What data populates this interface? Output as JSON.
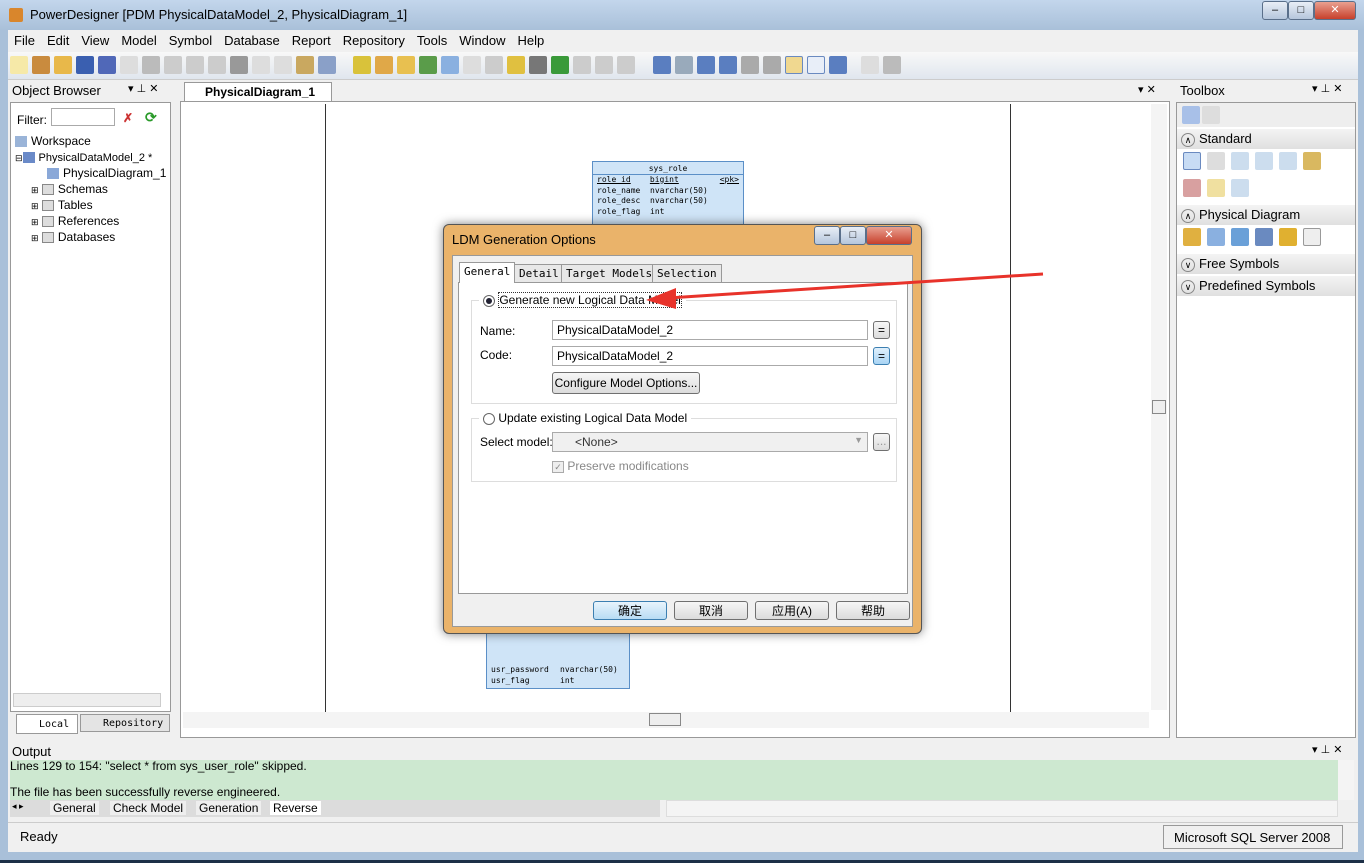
{
  "window": {
    "title": "PowerDesigner [PDM PhysicalDataModel_2, PhysicalDiagram_1]",
    "minimize": "–",
    "maximize": "□",
    "close": "✕"
  },
  "menu": [
    "File",
    "Edit",
    "View",
    "Model",
    "Symbol",
    "Database",
    "Report",
    "Repository",
    "Tools",
    "Window",
    "Help"
  ],
  "object_browser": {
    "title": "Object Browser",
    "filter_label": "Filter:",
    "filter_value": "",
    "tree": [
      {
        "label": "Workspace"
      },
      {
        "label": "PhysicalDataModel_2 *"
      },
      {
        "label": "PhysicalDiagram_1"
      },
      {
        "label": "Schemas"
      },
      {
        "label": "Tables"
      },
      {
        "label": "References"
      },
      {
        "label": "Databases"
      }
    ],
    "tabs": [
      "Local",
      "Repository"
    ]
  },
  "diagram": {
    "tab": "PhysicalDiagram_1",
    "sys_role": {
      "name": "sys_role",
      "columns": [
        {
          "name": "role_id",
          "type": "bigint",
          "key": "<pk>"
        },
        {
          "name": "role_name",
          "type": "nvarchar(50)",
          "key": ""
        },
        {
          "name": "role_desc",
          "type": "nvarchar(50)",
          "key": ""
        },
        {
          "name": "role_flag",
          "type": "int",
          "key": ""
        }
      ]
    },
    "sys_user": {
      "columns": [
        {
          "name": "usr_password",
          "type": "nvarchar(50)"
        },
        {
          "name": "usr_flag",
          "type": "int"
        }
      ]
    }
  },
  "toolbox": {
    "title": "Toolbox",
    "sections": [
      "Standard",
      "Physical Diagram",
      "Free Symbols",
      "Predefined Symbols"
    ]
  },
  "output": {
    "title": "Output",
    "lines": [
      "Lines  129 to  154:  \"select * from sys_user_role\" skipped.",
      "",
      "The file has been successfully reverse engineered."
    ],
    "tabs": [
      "General",
      "Check Model",
      "Generation",
      "Reverse"
    ]
  },
  "status": {
    "left": "Ready",
    "right": "Microsoft SQL Server 2008"
  },
  "dialog": {
    "title": "LDM Generation Options",
    "tabs": [
      "General",
      "Detail",
      "Target Models",
      "Selection"
    ],
    "generate_new": {
      "label": "Generate new Logical Data Model",
      "selected": true
    },
    "name_label": "Name:",
    "name_value": "PhysicalDataModel_2",
    "code_label": "Code:",
    "code_value": "PhysicalDataModel_2",
    "equal_btn": "=",
    "configure_btn": "Configure Model Options...",
    "update_existing": {
      "label": "Update existing Logical Data Model",
      "selected": false
    },
    "select_model_label": "Select model:",
    "select_model_value": "<None>",
    "browse_btn": "...",
    "preserve_label": "Preserve modifications",
    "preserve_checked": true,
    "buttons": {
      "ok": "确定",
      "cancel": "取消",
      "apply": "应用(A)",
      "help": "帮助"
    }
  },
  "colors": {
    "arrow": "#e8322a",
    "output_bg": "#cde8d0",
    "table_fill": "#cfe4f7",
    "dialog_frame": "#eab36a"
  }
}
